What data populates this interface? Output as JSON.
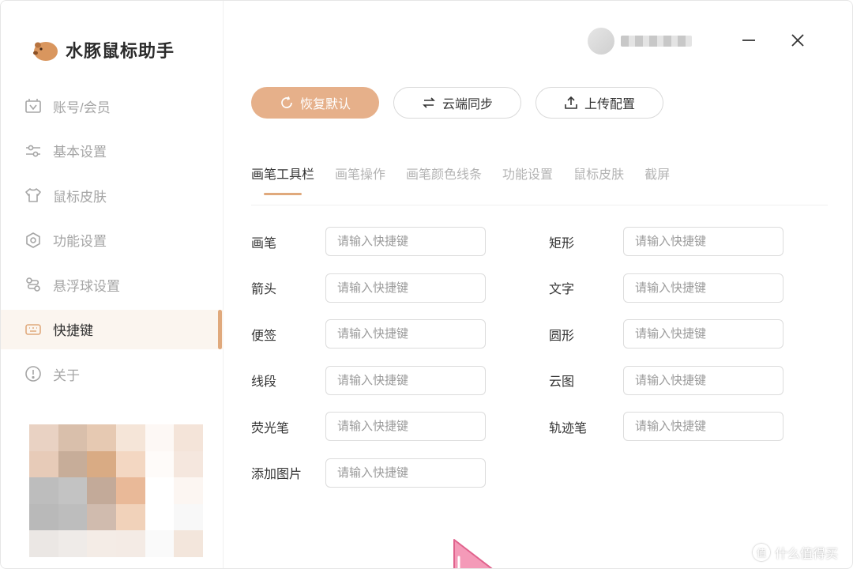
{
  "app": {
    "title": "水豚鼠标助手"
  },
  "sidebar": {
    "items": [
      {
        "label": "账号/会员",
        "icon": "member-icon",
        "active": false
      },
      {
        "label": "基本设置",
        "icon": "sliders-icon",
        "active": false
      },
      {
        "label": "鼠标皮肤",
        "icon": "tshirt-icon",
        "active": false
      },
      {
        "label": "功能设置",
        "icon": "hexagon-gear-icon",
        "active": false
      },
      {
        "label": "悬浮球设置",
        "icon": "float-ball-icon",
        "active": false
      },
      {
        "label": "快捷键",
        "icon": "keyboard-icon",
        "active": true
      },
      {
        "label": "关于",
        "icon": "info-icon",
        "active": false
      }
    ]
  },
  "toolbar": {
    "reset_label": "恢复默认",
    "sync_label": "云端同步",
    "upload_label": "上传配置"
  },
  "tabs": [
    {
      "label": "画笔工具栏",
      "active": true
    },
    {
      "label": "画笔操作",
      "active": false
    },
    {
      "label": "画笔颜色线条",
      "active": false
    },
    {
      "label": "功能设置",
      "active": false
    },
    {
      "label": "鼠标皮肤",
      "active": false
    },
    {
      "label": "截屏",
      "active": false
    }
  ],
  "shortcuts": {
    "placeholder": "请输入快捷键",
    "left": [
      {
        "label": "画笔",
        "value": ""
      },
      {
        "label": "箭头",
        "value": ""
      },
      {
        "label": "便签",
        "value": ""
      },
      {
        "label": "线段",
        "value": ""
      },
      {
        "label": "荧光笔",
        "value": ""
      },
      {
        "label": "添加图片",
        "value": ""
      }
    ],
    "right": [
      {
        "label": "矩形",
        "value": ""
      },
      {
        "label": "文字",
        "value": ""
      },
      {
        "label": "圆形",
        "value": ""
      },
      {
        "label": "云图",
        "value": ""
      },
      {
        "label": "轨迹笔",
        "value": ""
      }
    ]
  },
  "watermark": {
    "text": "什么值得买",
    "icon_glyph": "值"
  },
  "colors": {
    "accent": "#e6b08a",
    "accent_line": "#e0a97c",
    "active_bg": "#fbf5ef",
    "muted_text": "#a5a5a5"
  }
}
